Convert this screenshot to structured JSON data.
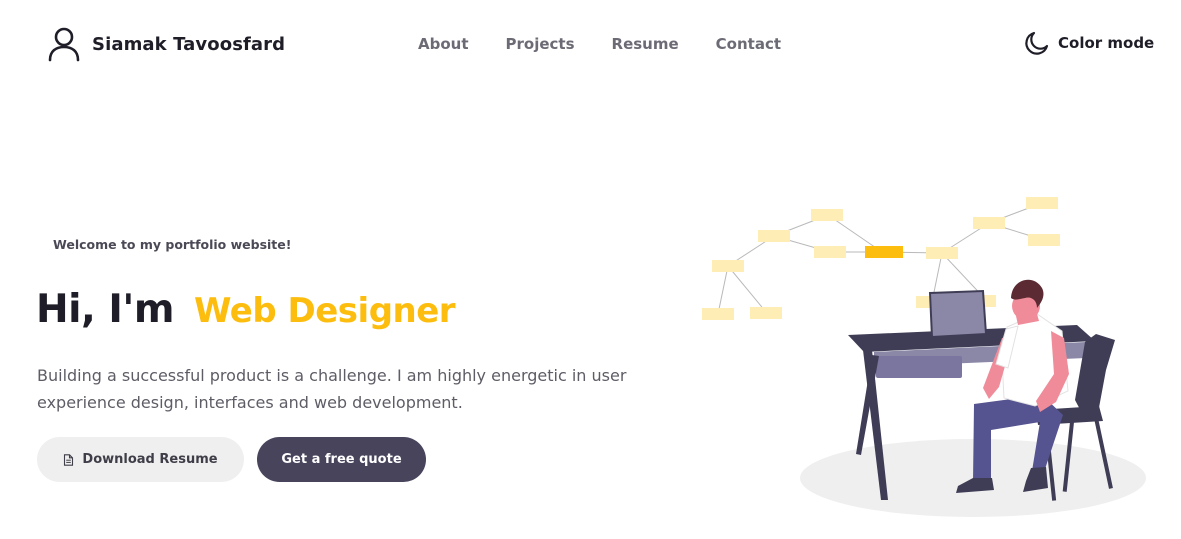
{
  "header": {
    "brand_name": "Siamak Tavoosfard",
    "brand_icon": "user-icon",
    "nav": [
      {
        "label": "About"
      },
      {
        "label": "Projects"
      },
      {
        "label": "Resume"
      },
      {
        "label": "Contact"
      }
    ],
    "color_mode_label": "Color mode",
    "color_mode_icon": "moon-icon"
  },
  "hero": {
    "welcome": "Welcome to my portfolio website!",
    "greeting": "Hi, I'm",
    "role": "Web Designer",
    "intro": "Building a successful product is a challenge. I am highly energetic in user experience design, interfaces and web development.",
    "buttons": {
      "download_resume": "Download Resume",
      "download_icon": "file-icon",
      "free_quote": "Get a free quote"
    }
  },
  "colors": {
    "accent": "#fcbd0f",
    "dark_button": "#47445c",
    "light_button": "#efefef",
    "text_dark": "#1f1e28",
    "nav_text": "#6c6b75"
  }
}
